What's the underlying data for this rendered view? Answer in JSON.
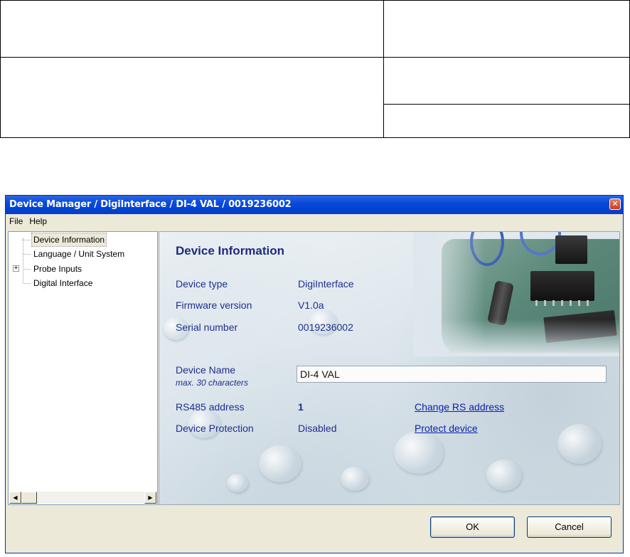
{
  "window": {
    "title": "Device Manager / DigiInterface / DI-4 VAL / 0019236002",
    "close_glyph": "✕"
  },
  "menu": {
    "items": [
      "File",
      "Help"
    ]
  },
  "tree": {
    "items": [
      {
        "label": "Device Information",
        "selected": true
      },
      {
        "label": "Language / Unit System"
      },
      {
        "label": "Probe Inputs",
        "expandable": true,
        "expander": "+"
      },
      {
        "label": "Digital Interface"
      }
    ],
    "scroll_left": "◀",
    "scroll_right": "▶"
  },
  "content": {
    "title": "Device Information",
    "device_type_label": "Device type",
    "device_type_value": "DigiInterface",
    "firmware_label": "Firmware version",
    "firmware_value": "V1.0a",
    "serial_label": "Serial number",
    "serial_value": "0019236002",
    "device_name_label": "Device Name",
    "device_name_hint": "max. 30 characters",
    "device_name_value": "DI-4 VAL",
    "rs485_label": "RS485 address",
    "rs485_value": "1",
    "rs485_link": "Change RS address",
    "protection_label": "Device Protection",
    "protection_value": "Disabled",
    "protection_link": "Protect device"
  },
  "buttons": {
    "ok": "OK",
    "cancel": "Cancel"
  }
}
